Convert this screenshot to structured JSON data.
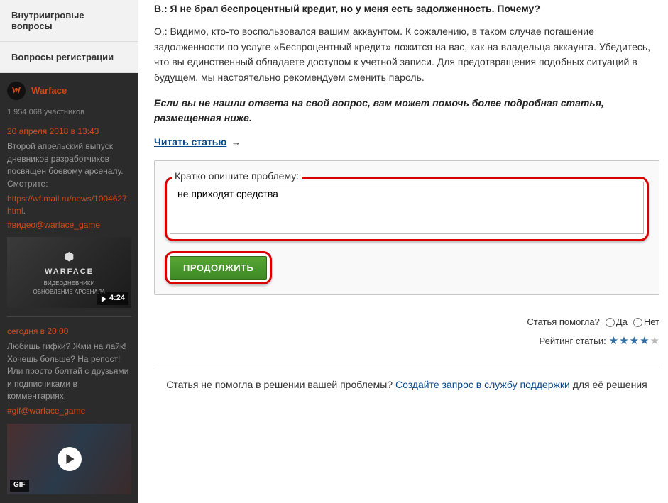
{
  "sidebar_nav": {
    "item1": "Внутриигровые вопросы",
    "item2": "Вопросы регистрации"
  },
  "widget": {
    "title": "Warface",
    "subscribers": "1 954 068 участников",
    "post1": {
      "date": "20 апреля 2018 в 13:43",
      "text": "Второй апрельский выпуск дневников разработчиков посвящен боевому арсеналу. Смотрите:",
      "link": "https://wf.mail.ru/news/1004627.html",
      "hash": "#видео@warface_game",
      "video_brand": "WARFACE",
      "video_sub1": "ВИДЕОДНЕВНИКИ",
      "video_sub2": "ОБНОВЛЕНИЕ АРСЕНАЛА",
      "duration": "4:24"
    },
    "post2": {
      "date": "сегодня в 20:00",
      "text": "Любишь гифки? Жми на лайк! Хочешь больше? На репост! Или просто болтай с друзьями и подписчиками в комментариях.",
      "hash": "#gif@warface_game",
      "badge": "GIF"
    }
  },
  "article": {
    "question": "В.: Я не брал беспроцентный кредит, но у меня есть задолженность. Почему?",
    "answer": "О.: Видимо, кто-то воспользовался вашим аккаунтом. К сожалению, в таком случае погашение задолженности по услуге «Беспроцентный кредит» ложится на вас, как на владельца аккаунта. Убедитесь, что вы единственный обладаете доступом к учетной записи. Для предотвращения подобных ситуаций в будущем, мы настоятельно рекомендуем сменить пароль.",
    "hint": "Если вы не нашли ответа на свой вопрос, вам может помочь более подробная статья, размещенная ниже.",
    "read_link": "Читать статью",
    "arrow": "→"
  },
  "form": {
    "legend": "Кратко опишите проблему:",
    "value": "не приходят средства",
    "button": "ПРОДОЛЖИТЬ"
  },
  "feedback": {
    "helpful_label": "Статья помогла?",
    "yes": "Да",
    "no": "Нет",
    "rating_label": "Рейтинг статьи:",
    "rating_value": 4,
    "rating_max": 5
  },
  "footer": {
    "text1": "Статья не помогла в решении вашей проблемы? ",
    "link": "Создайте запрос в службу поддержки",
    "text2": " для её решения"
  }
}
